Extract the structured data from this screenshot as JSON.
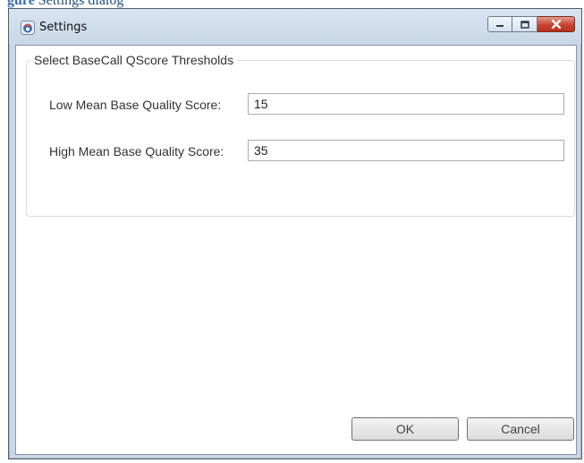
{
  "background": {
    "caption_prefix": "gure",
    "caption_rest": "  Settings dialog"
  },
  "window": {
    "title": "Settings",
    "caption_buttons": [
      "minimize-icon",
      "maximize-icon",
      "close-icon"
    ]
  },
  "group": {
    "legend": "Select BaseCall QScore Thresholds",
    "fields": [
      {
        "label": "Low Mean Base Quality Score:",
        "value": "15"
      },
      {
        "label": "High Mean Base Quality Score:",
        "value": "35"
      }
    ]
  },
  "buttons": {
    "ok": "OK",
    "cancel": "Cancel"
  },
  "colors": {
    "titlebar": "#c9d7e6",
    "close_button": "#c7432f",
    "window_border": "#4f5d6b"
  }
}
